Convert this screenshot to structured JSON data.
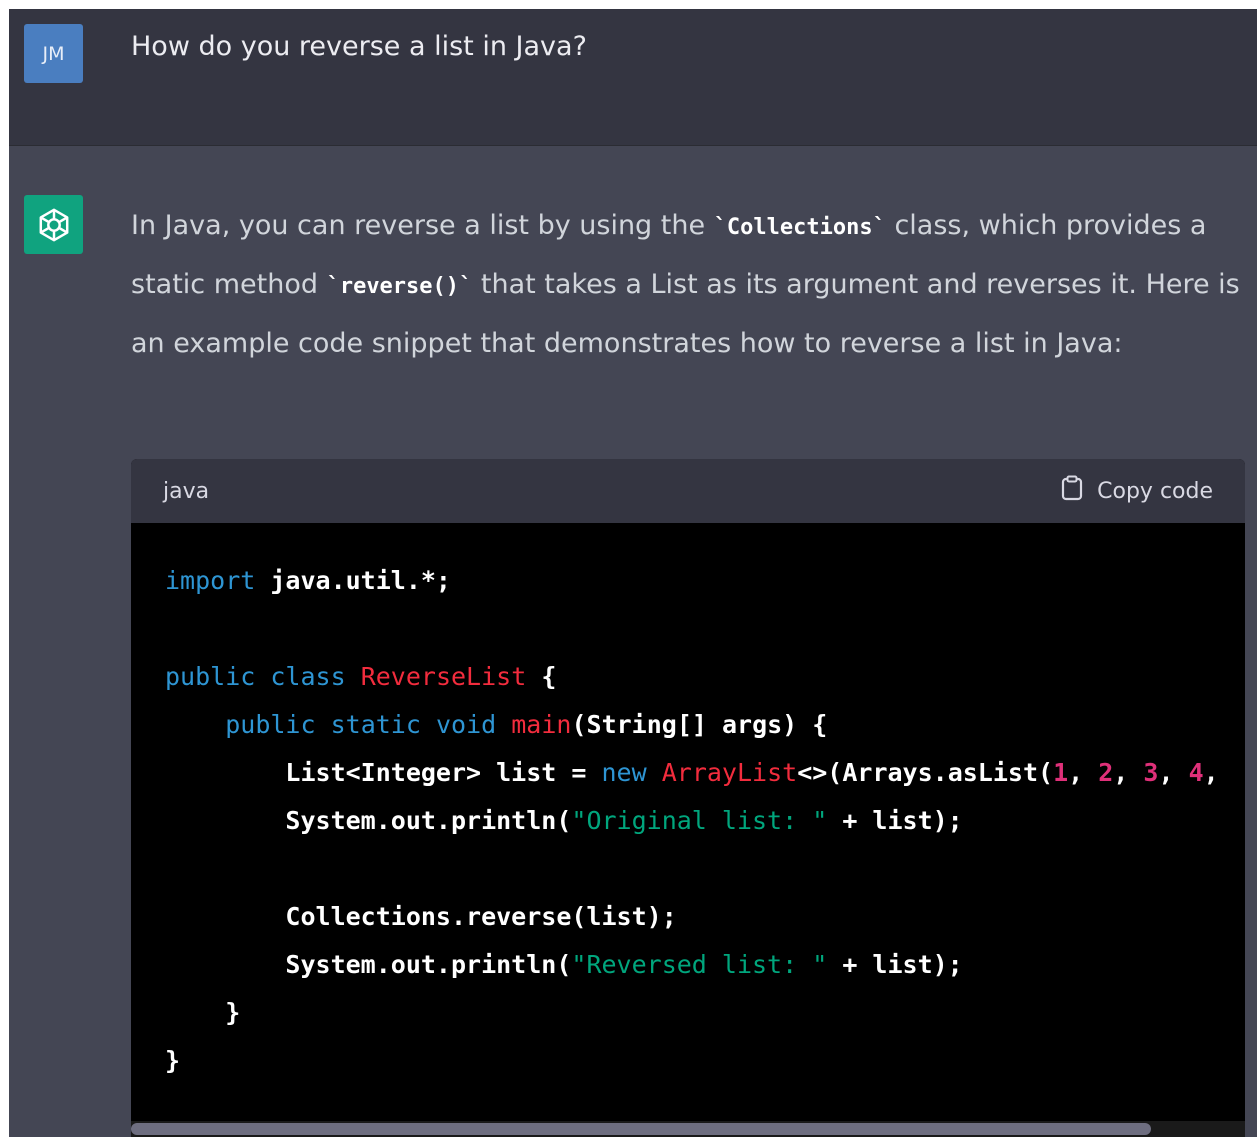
{
  "user_message": {
    "avatar_initials": "JM",
    "text": "How do you reverse a list in Java?"
  },
  "assistant_message": {
    "icon": "openai-logo-icon",
    "paragraph": [
      {
        "type": "text",
        "value": "In Java, you can reverse a list by using the "
      },
      {
        "type": "code",
        "value": "`Collections`"
      },
      {
        "type": "text",
        "value": " class, which provides a static method "
      },
      {
        "type": "code",
        "value": "`reverse()`"
      },
      {
        "type": "text",
        "value": " that takes a List as its argument and reverses it. Here is an example code snippet that demonstrates how to reverse a list in Java:"
      }
    ],
    "code_block": {
      "language": "java",
      "copy_label": "Copy code",
      "copy_icon": "clipboard-icon",
      "lines": [
        [
          {
            "t": "kw",
            "v": "import"
          },
          {
            "t": "p",
            "v": " java.util.*;"
          }
        ],
        [],
        [
          {
            "t": "kw",
            "v": "public"
          },
          {
            "t": "p",
            "v": " "
          },
          {
            "t": "kw",
            "v": "class"
          },
          {
            "t": "p",
            "v": " "
          },
          {
            "t": "ty",
            "v": "ReverseList"
          },
          {
            "t": "p",
            "v": " {"
          }
        ],
        [
          {
            "t": "p",
            "v": "    "
          },
          {
            "t": "kw",
            "v": "public"
          },
          {
            "t": "p",
            "v": " "
          },
          {
            "t": "kw",
            "v": "static"
          },
          {
            "t": "p",
            "v": " "
          },
          {
            "t": "kw",
            "v": "void"
          },
          {
            "t": "p",
            "v": " "
          },
          {
            "t": "ty",
            "v": "main"
          },
          {
            "t": "p",
            "v": "(String[] args) {"
          }
        ],
        [
          {
            "t": "p",
            "v": "        List<Integer> list = "
          },
          {
            "t": "kw",
            "v": "new"
          },
          {
            "t": "p",
            "v": " "
          },
          {
            "t": "ty",
            "v": "ArrayList"
          },
          {
            "t": "p",
            "v": "<>(Arrays.asList("
          },
          {
            "t": "num",
            "v": "1"
          },
          {
            "t": "p",
            "v": ", "
          },
          {
            "t": "num",
            "v": "2"
          },
          {
            "t": "p",
            "v": ", "
          },
          {
            "t": "num",
            "v": "3"
          },
          {
            "t": "p",
            "v": ", "
          },
          {
            "t": "num",
            "v": "4"
          },
          {
            "t": "p",
            "v": ","
          }
        ],
        [
          {
            "t": "p",
            "v": "        System.out.println("
          },
          {
            "t": "str",
            "v": "\"Original list: \""
          },
          {
            "t": "p",
            "v": " + list);"
          }
        ],
        [],
        [
          {
            "t": "p",
            "v": "        Collections.reverse(list);"
          }
        ],
        [
          {
            "t": "p",
            "v": "        System.out.println("
          },
          {
            "t": "str",
            "v": "\"Reversed list: \""
          },
          {
            "t": "p",
            "v": " + list);"
          }
        ],
        [
          {
            "t": "p",
            "v": "    }"
          }
        ],
        [
          {
            "t": "p",
            "v": "}"
          }
        ]
      ]
    }
  },
  "colors": {
    "user_bg": "#343541",
    "assistant_bg": "#444654",
    "avatar_bg": "#4a7ec0",
    "bot_icon_bg": "#10a37f",
    "keyword": "#2e95d3",
    "type_name": "#f22c3d",
    "number": "#df3079",
    "string": "#00a67d"
  }
}
